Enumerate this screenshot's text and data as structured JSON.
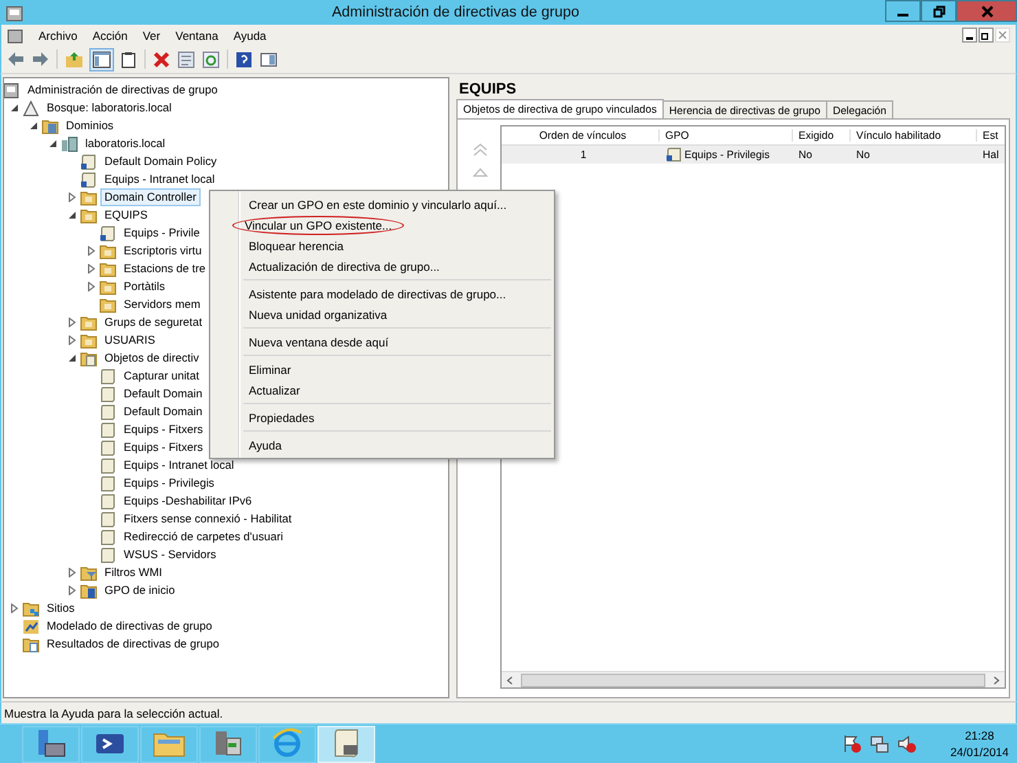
{
  "window": {
    "title": "Administración de directivas de grupo"
  },
  "menu": [
    "Archivo",
    "Acción",
    "Ver",
    "Ventana",
    "Ayuda"
  ],
  "tree": [
    {
      "label": "Administración de directivas de grupo",
      "kind": "console",
      "selected": false,
      "children": [
        {
          "label": "Bosque: laboratoris.local",
          "kind": "forest",
          "selected": false,
          "expanded": true,
          "children": [
            {
              "label": "Dominios",
              "kind": "domains",
              "selected": false,
              "expanded": true,
              "children": [
                {
                  "label": "laboratoris.local",
                  "kind": "domain",
                  "selected": false,
                  "expanded": true,
                  "children": [
                    {
                      "label": "Default Domain Policy",
                      "kind": "link",
                      "selected": false
                    },
                    {
                      "label": "Equips - Intranet local",
                      "kind": "link",
                      "selected": false
                    },
                    {
                      "label": "Domain Controller",
                      "kind": "ou",
                      "selected": true,
                      "expanded": false
                    },
                    {
                      "label": "EQUIPS",
                      "kind": "ou",
                      "selected": false,
                      "expanded": true,
                      "children": [
                        {
                          "label": "Equips - Privile",
                          "kind": "link",
                          "selected": false
                        },
                        {
                          "label": "Escriptoris virtu",
                          "kind": "ou",
                          "selected": false,
                          "expanded": false
                        },
                        {
                          "label": "Estacions de tre",
                          "kind": "ou",
                          "selected": false,
                          "expanded": false
                        },
                        {
                          "label": "Portàtils",
                          "kind": "ou",
                          "selected": false,
                          "expanded": false
                        },
                        {
                          "label": "Servidors mem",
                          "kind": "ou",
                          "selected": false
                        }
                      ]
                    },
                    {
                      "label": "Grups de seguretat",
                      "kind": "ou",
                      "selected": false,
                      "expanded": false
                    },
                    {
                      "label": "USUARIS",
                      "kind": "ou",
                      "selected": false,
                      "expanded": false
                    },
                    {
                      "label": "Objetos de directiv",
                      "kind": "gpofolder",
                      "selected": false,
                      "expanded": true,
                      "children": [
                        {
                          "label": "Capturar unitat",
                          "kind": "gpo",
                          "selected": false
                        },
                        {
                          "label": "Default Domain",
                          "kind": "gpo",
                          "selected": false
                        },
                        {
                          "label": "Default Domain",
                          "kind": "gpo",
                          "selected": false
                        },
                        {
                          "label": "Equips - Fitxers",
                          "kind": "gpo",
                          "selected": false
                        },
                        {
                          "label": "Equips - Fitxers",
                          "kind": "gpo",
                          "selected": false
                        },
                        {
                          "label": "Equips - Intranet local",
                          "kind": "gpo",
                          "selected": false
                        },
                        {
                          "label": "Equips - Privilegis",
                          "kind": "gpo",
                          "selected": false
                        },
                        {
                          "label": "Equips -Deshabilitar IPv6",
                          "kind": "gpo",
                          "selected": false
                        },
                        {
                          "label": "Fitxers sense connexió - Habilitat",
                          "kind": "gpo",
                          "selected": false
                        },
                        {
                          "label": "Redirecció de carpetes d'usuari",
                          "kind": "gpo",
                          "selected": false
                        },
                        {
                          "label": "WSUS - Servidors",
                          "kind": "gpo",
                          "selected": false
                        }
                      ]
                    },
                    {
                      "label": "Filtros WMI",
                      "kind": "filter",
                      "selected": false,
                      "expanded": false
                    },
                    {
                      "label": "GPO de inicio",
                      "kind": "starter",
                      "selected": false,
                      "expanded": false
                    }
                  ]
                }
              ]
            }
          ]
        },
        {
          "label": "Sitios",
          "kind": "sites",
          "selected": false,
          "expanded": false
        },
        {
          "label": "Modelado de directivas de grupo",
          "kind": "modeling",
          "selected": false
        },
        {
          "label": "Resultados de directivas de grupo",
          "kind": "results",
          "selected": false
        }
      ]
    }
  ],
  "context_menu": [
    [
      {
        "label": "Crear un GPO en este dominio y vincularlo aquí...",
        "circled": false
      },
      {
        "label": "Vincular un GPO existente...",
        "circled": true
      },
      {
        "label": "Bloquear herencia",
        "circled": false
      },
      {
        "label": "Actualización de directiva de grupo...",
        "circled": false
      }
    ],
    [
      {
        "label": "Asistente para modelado de directivas de grupo...",
        "circled": false
      },
      {
        "label": "Nueva unidad organizativa",
        "circled": false
      }
    ],
    [
      {
        "label": "Nueva ventana desde aquí",
        "circled": false
      }
    ],
    [
      {
        "label": "Eliminar",
        "circled": false
      },
      {
        "label": "Actualizar",
        "circled": false
      }
    ],
    [
      {
        "label": "Propiedades",
        "circled": false
      }
    ],
    [
      {
        "label": "Ayuda",
        "circled": false
      }
    ]
  ],
  "details": {
    "title": "EQUIPS",
    "tabs": [
      {
        "label": "Objetos de directiva de grupo vinculados",
        "selected": true
      },
      {
        "label": "Herencia de directivas de grupo",
        "selected": false
      },
      {
        "label": "Delegación",
        "selected": false
      }
    ],
    "columns": [
      "Orden de vínculos",
      "GPO",
      "Exigido",
      "Vínculo habilitado",
      "Est"
    ],
    "rows": [
      [
        "1",
        "Equips - Privilegis",
        "No",
        "No",
        "Hal"
      ]
    ]
  },
  "status_bar": "Muestra la Ayuda para la selección actual.",
  "taskbar": {
    "apps": [
      {
        "kind": "server",
        "selected": false
      },
      {
        "kind": "shell",
        "selected": false
      },
      {
        "kind": "folder",
        "selected": false
      },
      {
        "kind": "tools",
        "selected": false
      },
      {
        "kind": "browser",
        "selected": false
      },
      {
        "kind": "gpm",
        "selected": true
      }
    ],
    "time": "21:28",
    "date": "24/01/2014"
  }
}
